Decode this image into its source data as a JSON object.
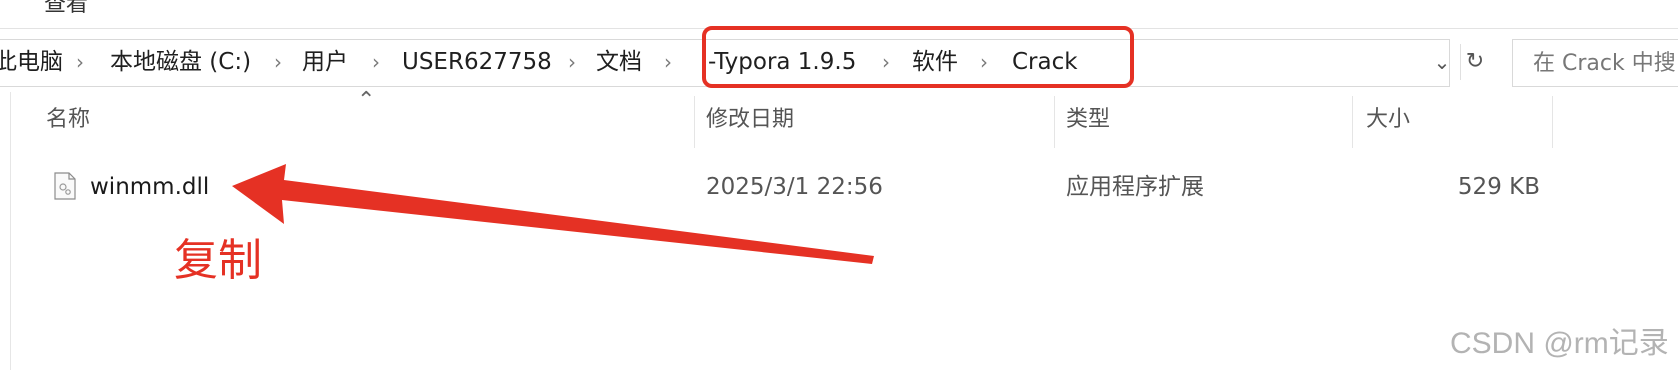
{
  "ribbon": {
    "tab_label": "查看"
  },
  "address": {
    "crumbs": [
      "此电脑",
      "本地磁盘 (C:)",
      "用户",
      "USER627758",
      "文档",
      "-Typora 1.9.5",
      "软件",
      "Crack"
    ],
    "separator": "›",
    "dropdown_icon": "chevron-down-icon",
    "refresh_icon": "refresh-icon"
  },
  "search": {
    "placeholder": "在 Crack 中搜"
  },
  "columns": {
    "name": "名称",
    "date": "修改日期",
    "type": "类型",
    "size": "大小"
  },
  "files": [
    {
      "name": "winmm.dll",
      "date": "2025/3/1 22:56",
      "type": "应用程序扩展",
      "size": "529 KB",
      "icon": "dll-file-icon"
    }
  ],
  "annotation": {
    "text": "复制",
    "color": "#e53124"
  },
  "watermark": "CSDN @rm记录",
  "colors": {
    "accent": "#e53124",
    "border": "#d9d9d9"
  }
}
